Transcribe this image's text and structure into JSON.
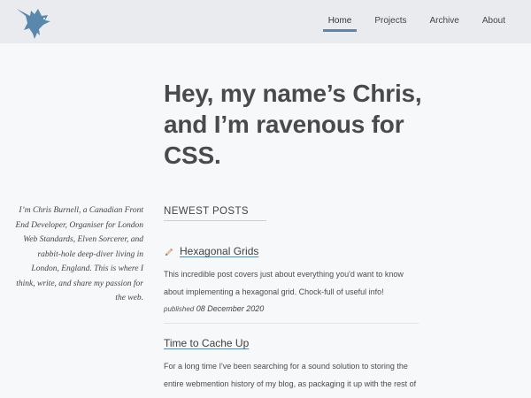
{
  "nav": {
    "items": [
      {
        "label": "Home",
        "active": true
      },
      {
        "label": "Projects",
        "active": false
      },
      {
        "label": "Archive",
        "active": false
      },
      {
        "label": "About",
        "active": false
      }
    ]
  },
  "logo": {
    "icon": "raven-icon",
    "color": "#5a88ad"
  },
  "hero": {
    "line1": "Hey, my name’s Chris,",
    "line2": "and I’m ravenous for",
    "line3": "CSS."
  },
  "bio": {
    "text": "I’m Chris Burnell, a Canadian Front End Developer, Organiser for London Web Standards, Elven Sorcerer, and rabbit-hole deep-diver living in London, England. This is where I think, write, and share my passion for the web."
  },
  "newest_posts": {
    "heading": "NEWEST POSTS",
    "posts": [
      {
        "icon": "pencil-emoji-icon",
        "title": "Hexagonal Grids",
        "summary": "This incredible post covers just about everything you'd want to know about implementing a hexagonal grid. Chock-full of useful info!",
        "published_label": "published",
        "date": "08 December 2020"
      },
      {
        "title": "Time to Cache Up",
        "summary": "For a long time I've been searching for a sound solution to storing the entire webmention history of my blog, as packaging it up with the rest of the repository was not cutting it for me. Enter the world …"
      }
    ]
  },
  "colors": {
    "accent": "#5a88ad",
    "header_bg": "#e9ebee",
    "page_bg": "#f7f8f9"
  }
}
